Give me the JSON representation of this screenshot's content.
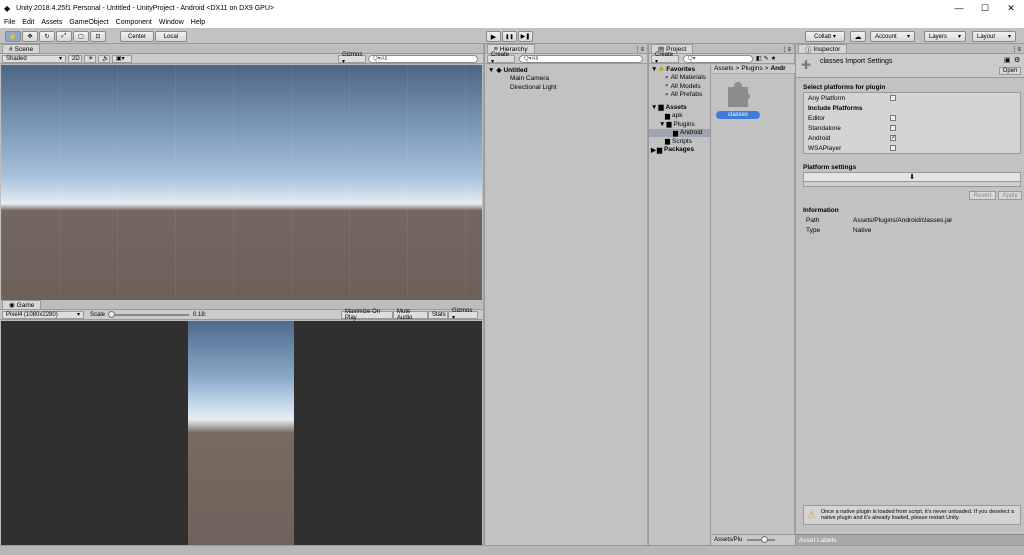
{
  "window": {
    "title": "Unity 2018.4.25f1 Personal - Untitled - UnityProject - Android <DX11 on DX9 GPU>",
    "minimize": "—",
    "maximize": "☐",
    "close": "✕"
  },
  "menu": [
    "File",
    "Edit",
    "Assets",
    "GameObject",
    "Component",
    "Window",
    "Help"
  ],
  "toolbar": {
    "pivot_center": "Center",
    "pivot_local": "Local",
    "play": "▶",
    "pause": "❚❚",
    "step": "▶❚",
    "collab": "Collab ▾",
    "account": "Account",
    "layers": "Layers",
    "layout": "Layout"
  },
  "scene": {
    "tab": "Scene",
    "shading": "Shaded",
    "mode2d": "2D",
    "gizmos": "Gizmos ▾",
    "search_placeholder": "Q▾All"
  },
  "game": {
    "tab": "Game",
    "display": "Pixel4 (1080x2280)",
    "scale_label": "Scale",
    "scale_value": "0.18:",
    "maximize": "Maximize On Play",
    "mute": "Mute Audio",
    "stats": "Stats",
    "gizmos": "Gizmos ▾"
  },
  "hierarchy": {
    "tab": "Hierarchy",
    "create": "Create ▾",
    "search_placeholder": "Q▾All",
    "scene_name": "Untitled",
    "items": [
      "Main Camera",
      "Directional Light"
    ]
  },
  "project": {
    "tab": "Project",
    "create": "Create ▾",
    "favorites": "Favorites",
    "favorites_items": [
      "All Materials",
      "All Models",
      "All Prefabs"
    ],
    "assets": "Assets",
    "asset_tree": [
      "apk",
      "Plugins",
      "Android",
      "Scripts"
    ],
    "packages": "Packages",
    "breadcrumb": [
      "Assets",
      ">",
      "Plugins",
      ">",
      "Andr"
    ],
    "file": "classes",
    "footer": "Assets/Plu"
  },
  "inspector": {
    "tab": "Inspector",
    "header": "classes Import Settings",
    "open_btn": "Open",
    "select_platforms": "Select platforms for plugin",
    "any_platform": "Any Platform",
    "include_platforms": "Include Platforms",
    "platforms": [
      {
        "name": "Editor",
        "checked": ""
      },
      {
        "name": "Standalone",
        "checked": ""
      },
      {
        "name": "Android",
        "checked": "✓"
      },
      {
        "name": "WSAPlayer",
        "checked": ""
      }
    ],
    "platform_settings": "Platform settings",
    "android_icon": "⬇",
    "revert": "Revert",
    "apply": "Apply",
    "information": "Information",
    "path_label": "Path",
    "path_value": "Assets/Plugins/Android/classes.jar",
    "type_label": "Type",
    "type_value": "Native",
    "warning": "Once a native plugin is loaded from script, it's never unloaded. If you deselect a native plugin and it's already loaded, please restart Unity.",
    "asset_labels": "Asset Labels"
  }
}
